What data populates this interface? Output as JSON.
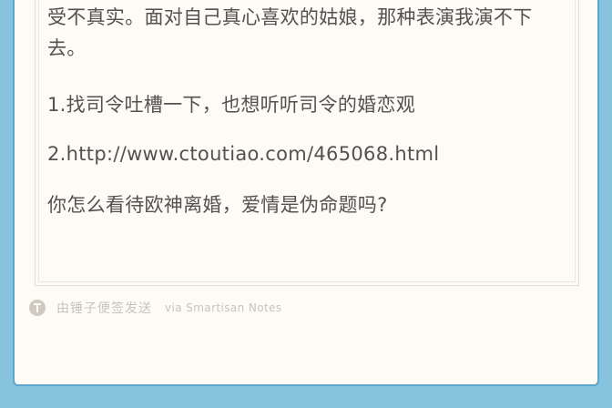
{
  "note": {
    "paragraphs": [
      "受不真实。面对自己真心喜欢的姑娘，那种表演我演不下去。",
      "1.找司令吐槽一下，也想听听司令的婚恋观",
      "2.http://www.ctoutiao.com/465068.html",
      "你怎么看待欧神离婚，爱情是伪命题吗?"
    ]
  },
  "footer": {
    "icon": "smartisan-logo-icon",
    "label": "由锤子便签发送",
    "via": "via Smartisan Notes"
  }
}
